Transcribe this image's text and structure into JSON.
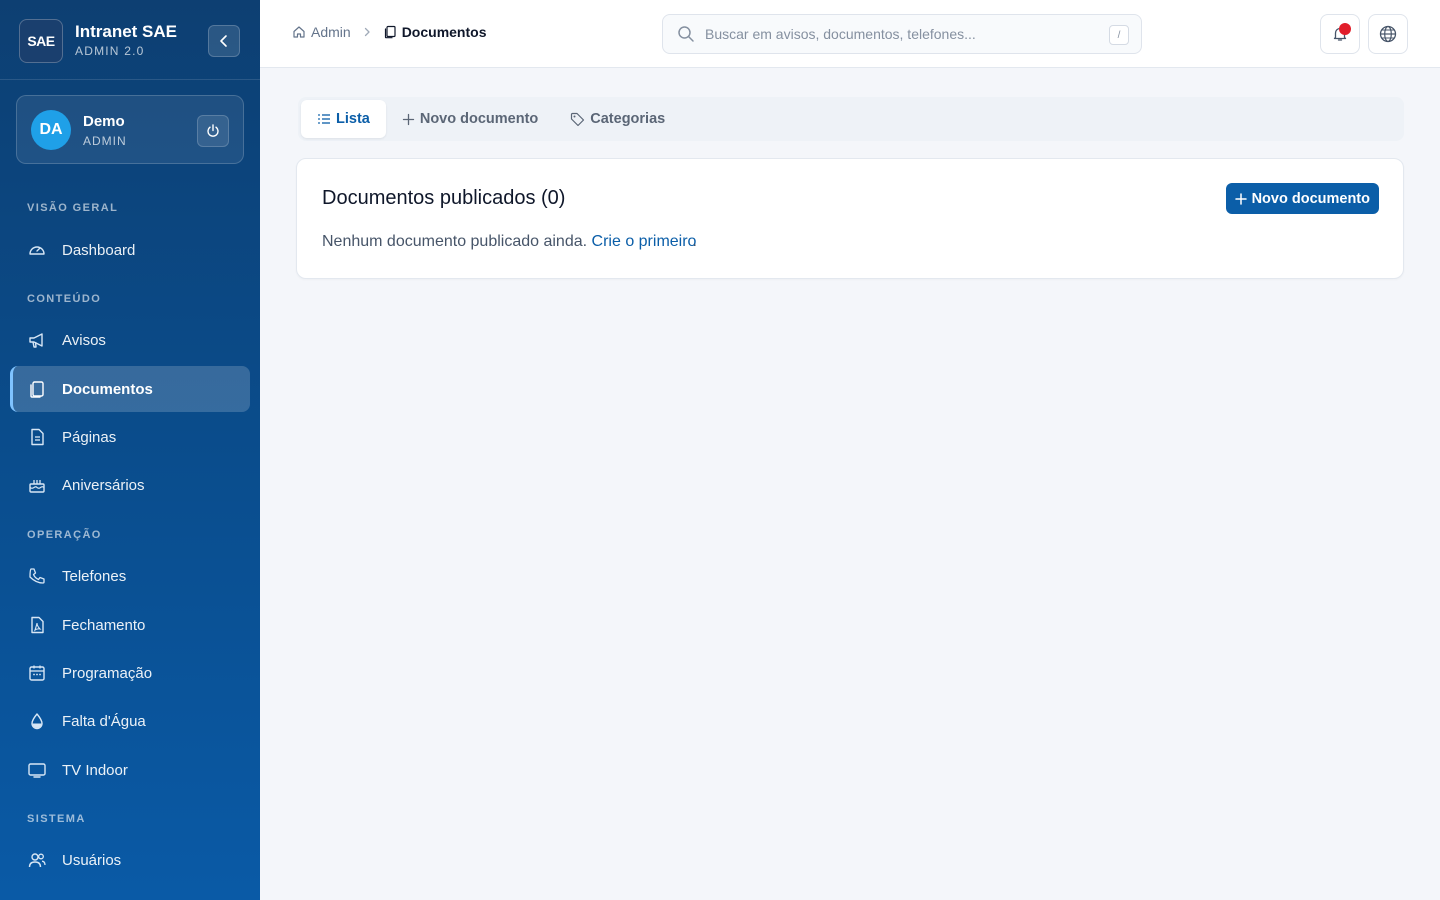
{
  "brand": {
    "logo_text": "SAE",
    "title": "Intranet SAE",
    "subtitle": "ADMIN 2.0"
  },
  "user": {
    "initials": "DA",
    "name": "Demo",
    "role": "ADMIN"
  },
  "sidebar": {
    "sections": [
      {
        "label": "VISÃO GERAL"
      },
      {
        "label": "CONTEÚDO"
      },
      {
        "label": "OPERAÇÃO"
      },
      {
        "label": "SISTEMA"
      }
    ],
    "items": [
      {
        "label": "Dashboard",
        "icon": "gauge-icon"
      },
      {
        "label": "Avisos",
        "icon": "megaphone-icon"
      },
      {
        "label": "Documentos",
        "icon": "documents-icon",
        "active": true
      },
      {
        "label": "Páginas",
        "icon": "page-icon"
      },
      {
        "label": "Aniversários",
        "icon": "cake-icon"
      },
      {
        "label": "Telefones",
        "icon": "phone-icon"
      },
      {
        "label": "Fechamento",
        "icon": "pdf-file-icon"
      },
      {
        "label": "Programação",
        "icon": "calendar-icon"
      },
      {
        "label": "Falta d'Água",
        "icon": "water-drop-icon"
      },
      {
        "label": "TV Indoor",
        "icon": "tv-icon"
      },
      {
        "label": "Usuários",
        "icon": "users-icon"
      }
    ]
  },
  "header": {
    "breadcrumb": [
      {
        "label": "Admin"
      },
      {
        "label": "Documentos"
      }
    ],
    "search_placeholder": "Buscar em avisos, documentos, telefones...",
    "search_shortcut": "/"
  },
  "tabs": [
    {
      "label": "Lista",
      "active": true
    },
    {
      "label": "Novo documento"
    },
    {
      "label": "Categorias"
    }
  ],
  "card": {
    "title": "Documentos publicados (0)",
    "empty_text": "Nenhum documento publicado ainda.",
    "empty_link": "Crie o primeiro",
    "empty_suffix": ".",
    "button_label": "Novo documento"
  },
  "colors": {
    "primary": "#0b5ea8",
    "sidebar_top": "#0d3f72",
    "sidebar_bottom": "#0a5aa6",
    "notification": "#e11d2a"
  }
}
